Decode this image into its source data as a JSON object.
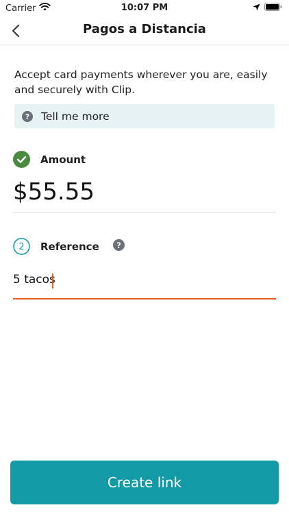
{
  "status_bar": {
    "carrier": "Carrier",
    "time": "10:07 PM"
  },
  "nav": {
    "title": "Pagos a Distancia",
    "back_icon": "chevron-left-icon"
  },
  "intro": {
    "text": "Accept card payments wherever you are, easily and securely with Clip."
  },
  "tell_me_more": {
    "label": "Tell me more",
    "icon": "question-circle-icon"
  },
  "amount": {
    "step_icon": "check-circle-icon",
    "label": "Amount",
    "value": "$55.55"
  },
  "reference": {
    "step_number": "2",
    "label": "Reference",
    "value": "5 tacos",
    "help_icon": "question-circle-icon"
  },
  "create_button": {
    "label": "Create link"
  },
  "colors": {
    "accent": "#139aa7",
    "check_green": "#4b8b3f",
    "input_focus": "#e35d1f",
    "info_bg": "#e6f2f3",
    "icon_gray": "#6b7078"
  }
}
